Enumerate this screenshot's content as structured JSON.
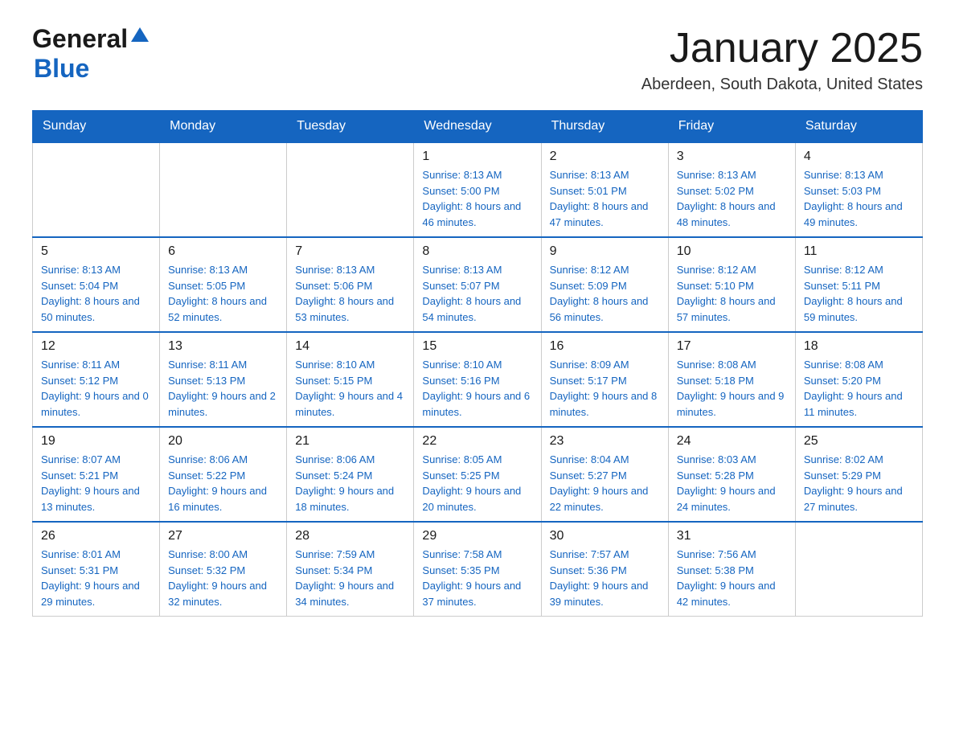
{
  "header": {
    "logo_general": "General",
    "logo_blue": "Blue",
    "title": "January 2025",
    "subtitle": "Aberdeen, South Dakota, United States"
  },
  "days_of_week": [
    "Sunday",
    "Monday",
    "Tuesday",
    "Wednesday",
    "Thursday",
    "Friday",
    "Saturday"
  ],
  "weeks": [
    [
      {
        "day": "",
        "sunrise": "",
        "sunset": "",
        "daylight": ""
      },
      {
        "day": "",
        "sunrise": "",
        "sunset": "",
        "daylight": ""
      },
      {
        "day": "",
        "sunrise": "",
        "sunset": "",
        "daylight": ""
      },
      {
        "day": "1",
        "sunrise": "Sunrise: 8:13 AM",
        "sunset": "Sunset: 5:00 PM",
        "daylight": "Daylight: 8 hours and 46 minutes."
      },
      {
        "day": "2",
        "sunrise": "Sunrise: 8:13 AM",
        "sunset": "Sunset: 5:01 PM",
        "daylight": "Daylight: 8 hours and 47 minutes."
      },
      {
        "day": "3",
        "sunrise": "Sunrise: 8:13 AM",
        "sunset": "Sunset: 5:02 PM",
        "daylight": "Daylight: 8 hours and 48 minutes."
      },
      {
        "day": "4",
        "sunrise": "Sunrise: 8:13 AM",
        "sunset": "Sunset: 5:03 PM",
        "daylight": "Daylight: 8 hours and 49 minutes."
      }
    ],
    [
      {
        "day": "5",
        "sunrise": "Sunrise: 8:13 AM",
        "sunset": "Sunset: 5:04 PM",
        "daylight": "Daylight: 8 hours and 50 minutes."
      },
      {
        "day": "6",
        "sunrise": "Sunrise: 8:13 AM",
        "sunset": "Sunset: 5:05 PM",
        "daylight": "Daylight: 8 hours and 52 minutes."
      },
      {
        "day": "7",
        "sunrise": "Sunrise: 8:13 AM",
        "sunset": "Sunset: 5:06 PM",
        "daylight": "Daylight: 8 hours and 53 minutes."
      },
      {
        "day": "8",
        "sunrise": "Sunrise: 8:13 AM",
        "sunset": "Sunset: 5:07 PM",
        "daylight": "Daylight: 8 hours and 54 minutes."
      },
      {
        "day": "9",
        "sunrise": "Sunrise: 8:12 AM",
        "sunset": "Sunset: 5:09 PM",
        "daylight": "Daylight: 8 hours and 56 minutes."
      },
      {
        "day": "10",
        "sunrise": "Sunrise: 8:12 AM",
        "sunset": "Sunset: 5:10 PM",
        "daylight": "Daylight: 8 hours and 57 minutes."
      },
      {
        "day": "11",
        "sunrise": "Sunrise: 8:12 AM",
        "sunset": "Sunset: 5:11 PM",
        "daylight": "Daylight: 8 hours and 59 minutes."
      }
    ],
    [
      {
        "day": "12",
        "sunrise": "Sunrise: 8:11 AM",
        "sunset": "Sunset: 5:12 PM",
        "daylight": "Daylight: 9 hours and 0 minutes."
      },
      {
        "day": "13",
        "sunrise": "Sunrise: 8:11 AM",
        "sunset": "Sunset: 5:13 PM",
        "daylight": "Daylight: 9 hours and 2 minutes."
      },
      {
        "day": "14",
        "sunrise": "Sunrise: 8:10 AM",
        "sunset": "Sunset: 5:15 PM",
        "daylight": "Daylight: 9 hours and 4 minutes."
      },
      {
        "day": "15",
        "sunrise": "Sunrise: 8:10 AM",
        "sunset": "Sunset: 5:16 PM",
        "daylight": "Daylight: 9 hours and 6 minutes."
      },
      {
        "day": "16",
        "sunrise": "Sunrise: 8:09 AM",
        "sunset": "Sunset: 5:17 PM",
        "daylight": "Daylight: 9 hours and 8 minutes."
      },
      {
        "day": "17",
        "sunrise": "Sunrise: 8:08 AM",
        "sunset": "Sunset: 5:18 PM",
        "daylight": "Daylight: 9 hours and 9 minutes."
      },
      {
        "day": "18",
        "sunrise": "Sunrise: 8:08 AM",
        "sunset": "Sunset: 5:20 PM",
        "daylight": "Daylight: 9 hours and 11 minutes."
      }
    ],
    [
      {
        "day": "19",
        "sunrise": "Sunrise: 8:07 AM",
        "sunset": "Sunset: 5:21 PM",
        "daylight": "Daylight: 9 hours and 13 minutes."
      },
      {
        "day": "20",
        "sunrise": "Sunrise: 8:06 AM",
        "sunset": "Sunset: 5:22 PM",
        "daylight": "Daylight: 9 hours and 16 minutes."
      },
      {
        "day": "21",
        "sunrise": "Sunrise: 8:06 AM",
        "sunset": "Sunset: 5:24 PM",
        "daylight": "Daylight: 9 hours and 18 minutes."
      },
      {
        "day": "22",
        "sunrise": "Sunrise: 8:05 AM",
        "sunset": "Sunset: 5:25 PM",
        "daylight": "Daylight: 9 hours and 20 minutes."
      },
      {
        "day": "23",
        "sunrise": "Sunrise: 8:04 AM",
        "sunset": "Sunset: 5:27 PM",
        "daylight": "Daylight: 9 hours and 22 minutes."
      },
      {
        "day": "24",
        "sunrise": "Sunrise: 8:03 AM",
        "sunset": "Sunset: 5:28 PM",
        "daylight": "Daylight: 9 hours and 24 minutes."
      },
      {
        "day": "25",
        "sunrise": "Sunrise: 8:02 AM",
        "sunset": "Sunset: 5:29 PM",
        "daylight": "Daylight: 9 hours and 27 minutes."
      }
    ],
    [
      {
        "day": "26",
        "sunrise": "Sunrise: 8:01 AM",
        "sunset": "Sunset: 5:31 PM",
        "daylight": "Daylight: 9 hours and 29 minutes."
      },
      {
        "day": "27",
        "sunrise": "Sunrise: 8:00 AM",
        "sunset": "Sunset: 5:32 PM",
        "daylight": "Daylight: 9 hours and 32 minutes."
      },
      {
        "day": "28",
        "sunrise": "Sunrise: 7:59 AM",
        "sunset": "Sunset: 5:34 PM",
        "daylight": "Daylight: 9 hours and 34 minutes."
      },
      {
        "day": "29",
        "sunrise": "Sunrise: 7:58 AM",
        "sunset": "Sunset: 5:35 PM",
        "daylight": "Daylight: 9 hours and 37 minutes."
      },
      {
        "day": "30",
        "sunrise": "Sunrise: 7:57 AM",
        "sunset": "Sunset: 5:36 PM",
        "daylight": "Daylight: 9 hours and 39 minutes."
      },
      {
        "day": "31",
        "sunrise": "Sunrise: 7:56 AM",
        "sunset": "Sunset: 5:38 PM",
        "daylight": "Daylight: 9 hours and 42 minutes."
      },
      {
        "day": "",
        "sunrise": "",
        "sunset": "",
        "daylight": ""
      }
    ]
  ]
}
